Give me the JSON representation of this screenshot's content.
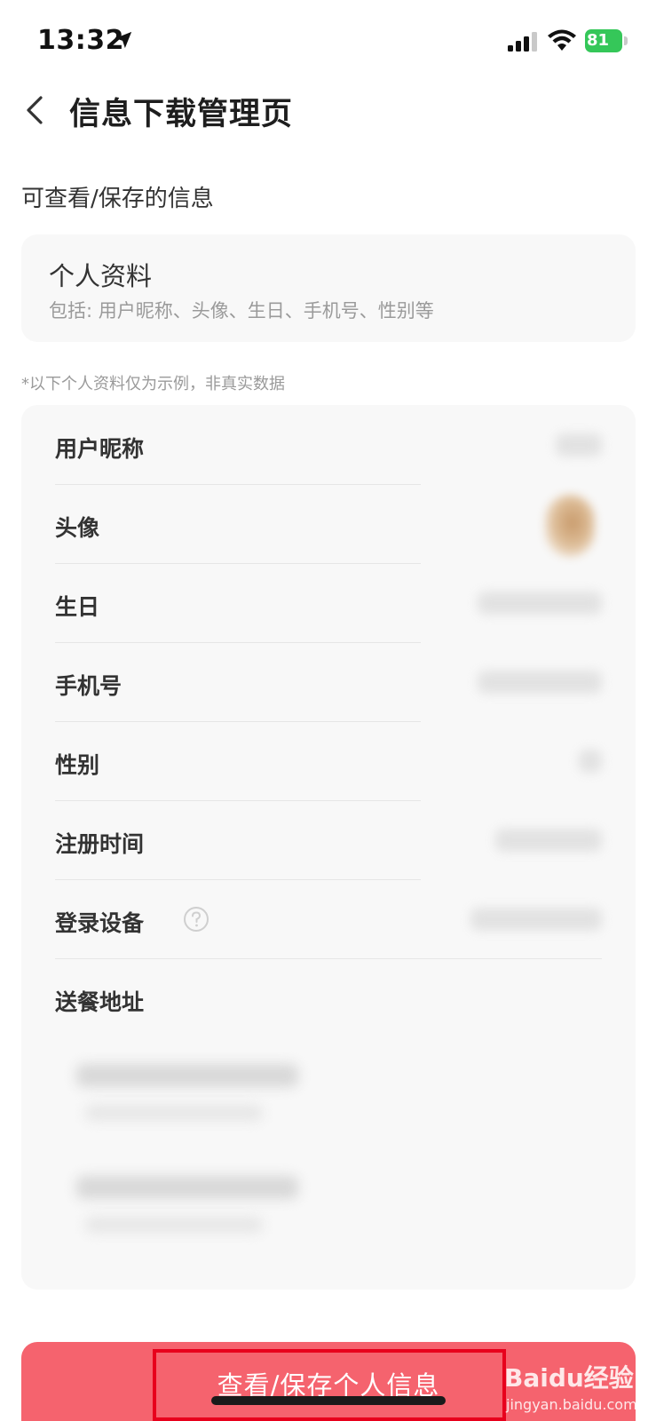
{
  "status_bar": {
    "time": "13:32",
    "battery": "81"
  },
  "nav": {
    "title": "信息下载管理页"
  },
  "section_title": "可查看/保存的信息",
  "profile_card": {
    "title": "个人资料",
    "description": "包括: 用户昵称、头像、生日、手机号、性别等"
  },
  "note": "*以下个人资料仅为示例，非真实数据",
  "fields": [
    {
      "label": "用户昵称"
    },
    {
      "label": "头像"
    },
    {
      "label": "生日"
    },
    {
      "label": "手机号"
    },
    {
      "label": "性别"
    },
    {
      "label": "注册时间"
    },
    {
      "label": "登录设备"
    },
    {
      "label": "送餐地址"
    }
  ],
  "bottom_button": {
    "label": "查看/保存个人信息"
  },
  "watermark": {
    "brand": "Baidu经验",
    "domain": "jingyan.baidu.com"
  },
  "colors": {
    "button": "#f5636e",
    "highlight": "#e8001c",
    "battery": "#35c759"
  }
}
